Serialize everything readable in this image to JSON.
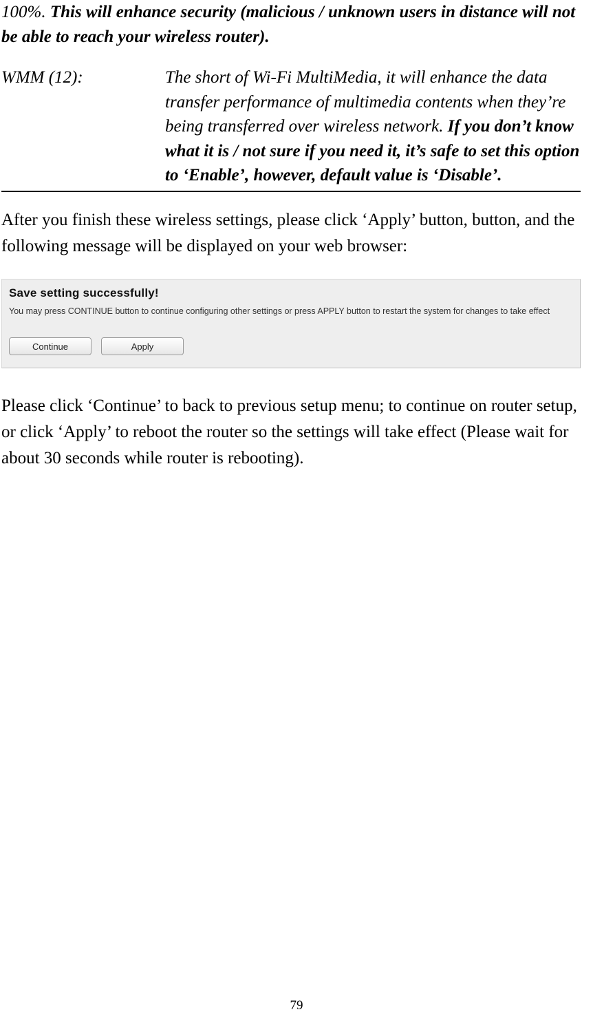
{
  "definitions": {
    "row1": {
      "normal": "100%. ",
      "bold": "This will enhance security (malicious / unknown users in distance will not be able to reach your wireless router)."
    },
    "row2": {
      "label": "WMM (12):",
      "normal": "The short of Wi-Fi MultiMedia, it will enhance the data transfer performance of multimedia contents when they’re being transferred over wireless network. ",
      "bold": "If you don’t know what it is / not sure if you need it, it’s safe to set this option to ‘Enable’, however, default value is ‘Disable’."
    }
  },
  "para_after_table": "After you finish these wireless settings, please click ‘Apply’ button, button, and the following message will be displayed on your web browser:",
  "dialog": {
    "title": "Save setting successfully!",
    "message": "You may press CONTINUE button to continue configuring other settings or press APPLY button to restart the system for changes to take effect",
    "buttons": {
      "continue": "Continue",
      "apply": "Apply"
    }
  },
  "para_after_dialog": "Please click ‘Continue’ to back to previous setup menu; to continue on router setup, or click ‘Apply’ to reboot the router so the settings will take effect (Please wait for about 30 seconds while router is rebooting).",
  "page_number": "79"
}
